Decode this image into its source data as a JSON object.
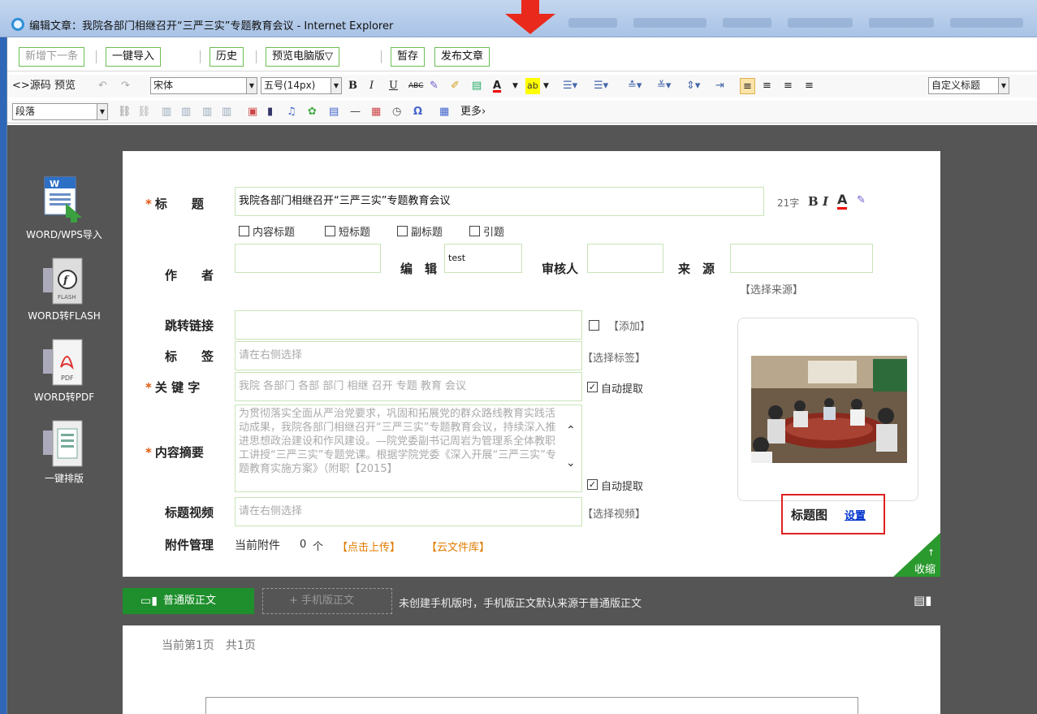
{
  "window": {
    "title": "编辑文章：我院各部门相继召开“三严三实”专题教育会议 - Internet Explorer"
  },
  "action_bar": {
    "new_next": "新增下一条",
    "import": "一键导入",
    "history": "历史",
    "preview": "预览电脑版▽",
    "draft": "暂存",
    "publish": "发布文章"
  },
  "toolbar": {
    "source": "<>源码",
    "preview": "预览",
    "font_family": "宋体",
    "font_size": "五号(14px)",
    "bold": "B",
    "italic": "I",
    "underline": "U",
    "strike": "ABC",
    "font_color": "A",
    "custom_title": "自定义标题",
    "paragraph": "段落",
    "more": "更多›"
  },
  "sidebar": {
    "items": [
      {
        "label": "WORD/WPS导入"
      },
      {
        "label": "WORD转FLASH"
      },
      {
        "label": "WORD转PDF"
      },
      {
        "label": "一键排版"
      }
    ]
  },
  "form": {
    "title_label": "标　　题",
    "title_value": "我院各部门相继召开“三严三实”专题教育会议",
    "char_count": "21字",
    "title_options": [
      "内容标题",
      "短标题",
      "副标题",
      "引题"
    ],
    "author_label": "作　　者",
    "author_value": "",
    "editor_label": "编　辑",
    "editor_value": "test",
    "reviewer_label": "审核人",
    "reviewer_value": "",
    "source_label": "来　源",
    "source_value": "",
    "select_source": "【选择来源】",
    "redirect_label": "跳转链接",
    "redirect_value": "",
    "add_link": "【添加】",
    "tags_label": "标　　签",
    "tags_placeholder": "请在右侧选择",
    "select_tags": "【选择标签】",
    "keywords_label": "关 键 字",
    "keywords_value": "我院 各部门 各部 部门 相继 召开 专题 教育 会议",
    "auto_extract": "自动提取",
    "summary_label": "内容摘要",
    "summary_value": "为贯彻落实全面从严治党要求，巩固和拓展党的群众路线教育实践活动成果，我院各部门相继召开“三严三实”专题教育会议，持续深入推进思想政治建设和作风建设。—院党委副书记周岩为管理系全体教职工讲授“三严三实”专题党课。根据学院党委《深入开展“三严三实”专题教育实施方案》（附职【2015】",
    "auto_extract2": "自动提取",
    "video_label": "标题视频",
    "video_placeholder": "请在右侧选择",
    "select_video": "【选择视频】",
    "attach_label": "附件管理",
    "attach_current": "当前附件",
    "attach_count": "0",
    "attach_unit": "个",
    "upload": "【点击上传】",
    "cloud": "【云文件库】",
    "title_image_label": "标题图",
    "title_image_set": "设置",
    "collapse": "收缩"
  },
  "tabs": {
    "normal": "普通版正文",
    "mobile": "+ 手机版正文",
    "note": "未创建手机版时，手机版正文默认来源于普通版正文"
  },
  "doc": {
    "page_info": "当前第1页　共1页"
  }
}
